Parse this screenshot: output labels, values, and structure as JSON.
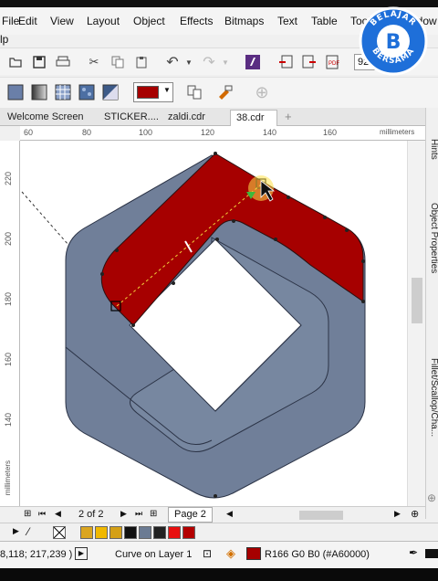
{
  "menu": [
    "File",
    "Edit",
    "View",
    "Layout",
    "Object",
    "Effects",
    "Bitmaps",
    "Text",
    "Table",
    "Tools",
    "Window"
  ],
  "help_label": "lp",
  "toolbar": {
    "zoom_value": "92"
  },
  "propbar": {
    "fill_color": "#A60000"
  },
  "tabs": [
    {
      "label": "Welcome Screen"
    },
    {
      "label": "STICKER...."
    },
    {
      "label": "zaldi.cdr"
    },
    {
      "label": "38.cdr"
    }
  ],
  "add_tab": "+",
  "ruler": {
    "top_ticks": [
      "60",
      "80",
      "100",
      "120",
      "140",
      "160"
    ],
    "top_unit": "millimeters",
    "left_ticks": [
      "220",
      "200",
      "180",
      "160",
      "140"
    ],
    "left_unit": "millimeters"
  },
  "right_panel": [
    "Hints",
    "Object Properties",
    "Fillet/Scallop/Cha..."
  ],
  "pagenav": {
    "page_count": "2 of 2",
    "page_tab": "Page 2"
  },
  "palette": {
    "colors": [
      "#DAA520",
      "#F0B800",
      "#D4A017",
      "#111111",
      "#6B7B93",
      "#222222",
      "#E81010",
      "#B40000"
    ]
  },
  "status": {
    "coords": "8,118; 217,239 )",
    "object_info": "Curve on Layer 1",
    "fill_info": "R166 G0 B0 (#A60000)",
    "fill_color": "#A60000"
  },
  "badge": {
    "top": "BELAJAR",
    "bottom": "BERSAMA",
    "letter": "B"
  }
}
